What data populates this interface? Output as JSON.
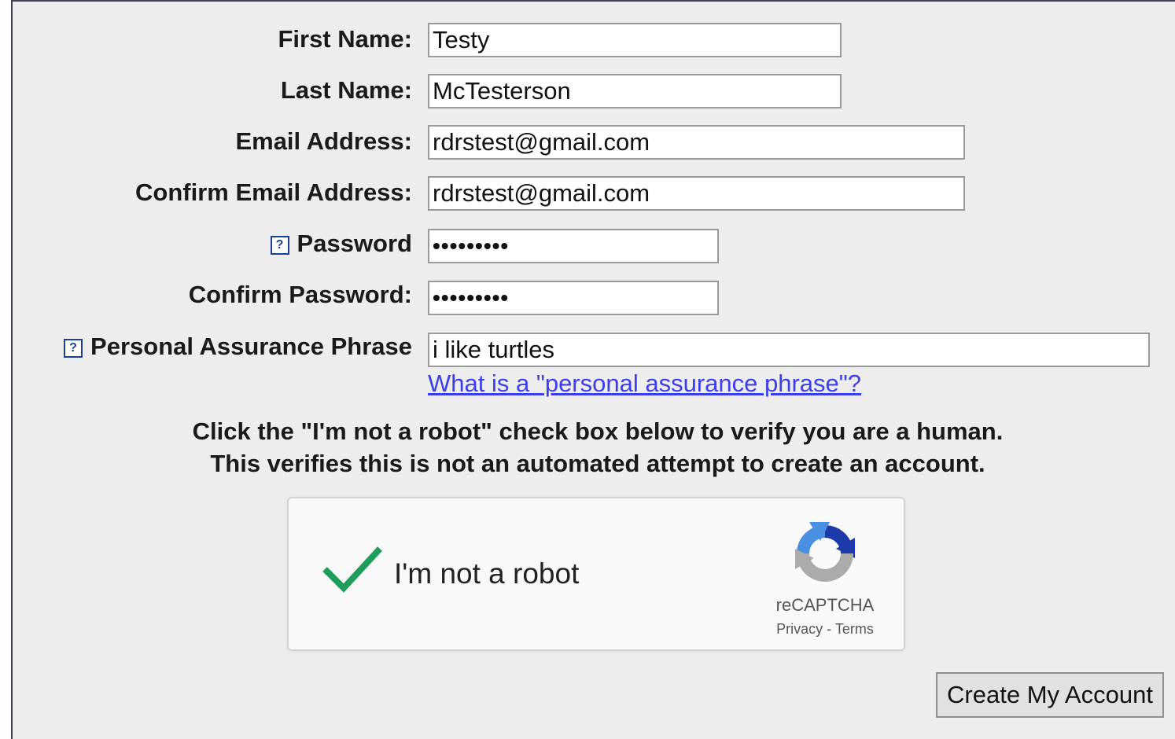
{
  "form": {
    "first_name": {
      "label": "First Name:",
      "value": "Testy"
    },
    "last_name": {
      "label": "Last Name:",
      "value": "McTesterson"
    },
    "email": {
      "label": "Email Address:",
      "value": "rdrstest@gmail.com"
    },
    "confirm_email": {
      "label": "Confirm Email Address:",
      "value": "rdrstest@gmail.com"
    },
    "password": {
      "label": "Password",
      "value": "•••••••••",
      "help_icon": "?"
    },
    "confirm_password": {
      "label": "Confirm Password:",
      "value": "•••••••••"
    },
    "assurance_phrase": {
      "label": "Personal Assurance Phrase",
      "value": "i like turtles",
      "help_icon": "?"
    },
    "assurance_link": "What is a \"personal assurance phrase\"?"
  },
  "notice": {
    "line1": "Click the \"I'm not a robot\" check box below to verify you are a human.",
    "line2": "This verifies this is not an automated attempt to create an account."
  },
  "captcha": {
    "label": "I'm not a robot",
    "checked": true,
    "brand": "reCAPTCHA",
    "privacy": "Privacy",
    "separator": "-",
    "terms": "Terms",
    "check_color": "#1e9e5a",
    "logo_icon": "recaptcha-logo-icon"
  },
  "submit_label": "Create My Account",
  "colors": {
    "background": "#ededed",
    "link": "#3d3df0",
    "help_icon": "#1a3f9b"
  }
}
